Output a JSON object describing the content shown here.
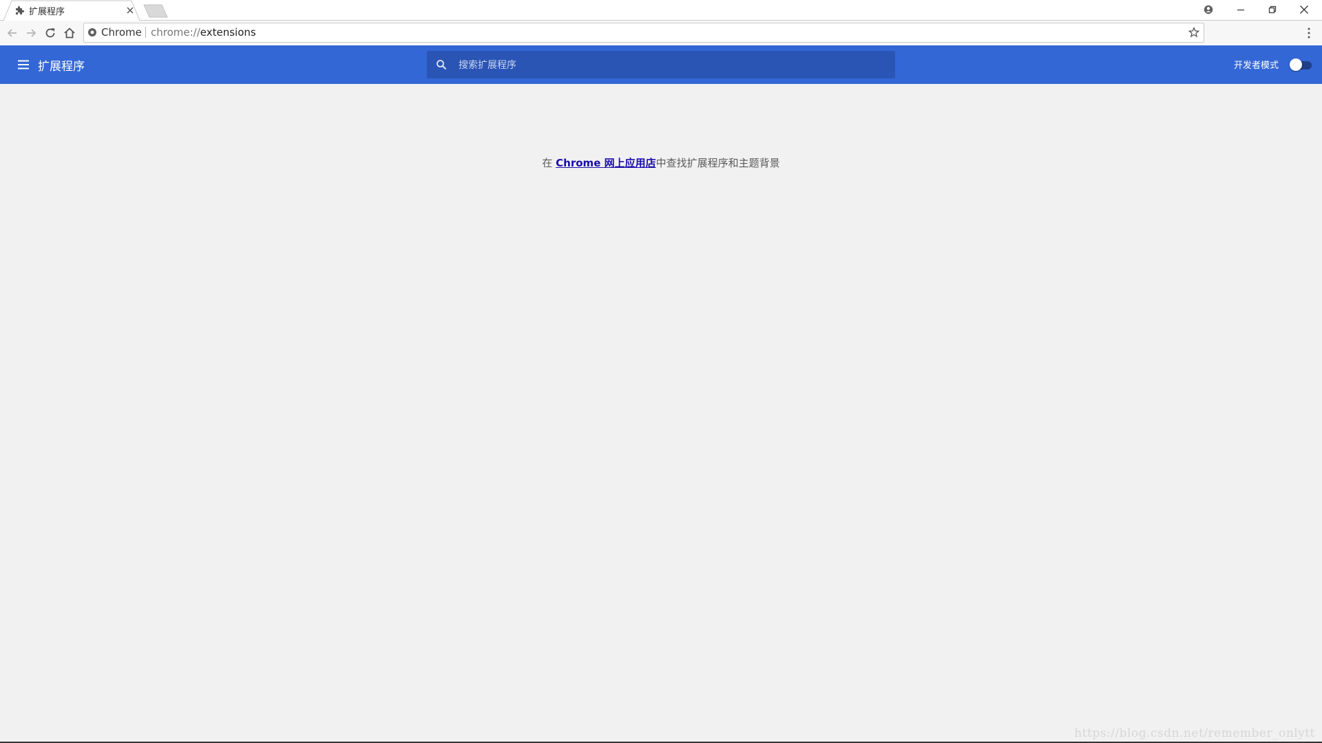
{
  "tab": {
    "title": "扩展程序",
    "favicon": "puzzle-icon",
    "close": "close-icon"
  },
  "window_controls": [
    "account-icon",
    "minimize-icon",
    "restore-icon",
    "close-icon"
  ],
  "toolbar": {
    "back": "back-arrow-icon",
    "forward": "forward-arrow-icon",
    "reload": "reload-icon",
    "home": "home-icon",
    "omnibox": {
      "chip": "Chrome",
      "url_scheme": "chrome://",
      "url_path": "extensions"
    },
    "bookmark": "star-icon",
    "menu": "more-vert-icon"
  },
  "header": {
    "title": "扩展程序",
    "search_placeholder": "搜索扩展程序",
    "dev_mode_label": "开发者模式",
    "dev_mode_on": false
  },
  "main": {
    "prefix": "在 ",
    "link": "Chrome 网上应用店",
    "suffix": "中查找扩展程序和主题背景"
  },
  "watermark": "https://blog.csdn.net/remember_onlytt",
  "colors": {
    "header": "#3367d6",
    "search_bg": "#2a55b5",
    "page_bg": "#f1f1f1",
    "link": "#1a0dab"
  }
}
